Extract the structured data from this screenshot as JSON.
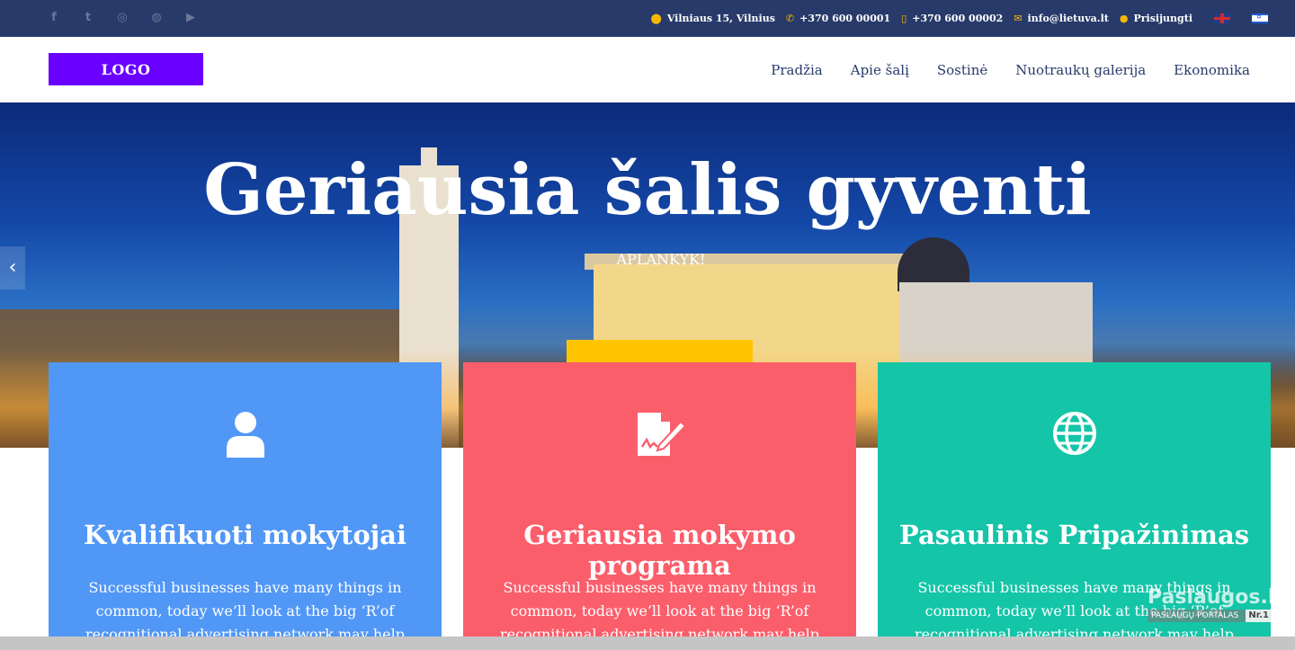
{
  "topbar": {
    "social_icons": [
      "facebook-icon",
      "twitter-icon",
      "github-icon",
      "dribbble-icon",
      "youtube-icon"
    ],
    "address": "Vilniaus 15, Vilnius",
    "phone1": "+370 600 00001",
    "phone2": "+370 600 00002",
    "email": "info@lietuva.lt",
    "login": "Prisijungti",
    "languages": [
      "en-flag-icon",
      "il-flag-icon"
    ]
  },
  "header": {
    "logo": "LOGO",
    "nav": [
      "Pradžia",
      "Apie šalį",
      "Sostinė",
      "Nuotraukų galerija",
      "Ekonomika"
    ]
  },
  "hero": {
    "title": "Geriausia šalis gyventi",
    "subtitle": "APLANKYK!"
  },
  "cards": [
    {
      "icon": "user-icon",
      "title": "Kvalifikuoti mokytojai",
      "text": "Successful businesses have many things in common, today we’ll look at the big ‘R’of recognitional advertising network may help",
      "color": "#5197f6"
    },
    {
      "icon": "document-signature-icon",
      "title": "Geriausia mokymo programa",
      "text": "Successful businesses have many things in common, today we’ll look at the big ‘R’of recognitional advertising network may help",
      "color": "#fb5e6b"
    },
    {
      "icon": "globe-icon",
      "title": "Pasaulinis Pripažinimas",
      "text": "Successful businesses have many things in common, today we’ll look at the big ‘R’of recognitional advertising network may help",
      "color": "#14c5a8"
    }
  ],
  "watermark": {
    "brand": "Paslaugos.lt",
    "tagline": "PASLAUGŲ PORTALAS",
    "badge": "Nr.1"
  },
  "colors": {
    "topbar": "#283a6a",
    "logo_bg": "#6a00ff",
    "accent_yellow": "#ffc400"
  }
}
